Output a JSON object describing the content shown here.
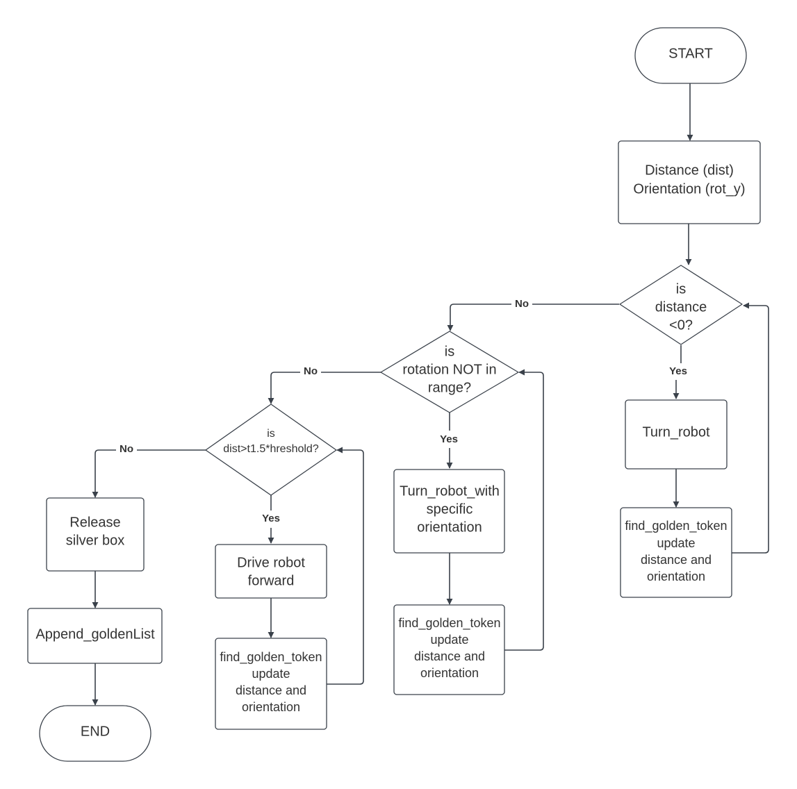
{
  "colors": {
    "line": "#3a414a",
    "text": "#333333",
    "background": "#ffffff"
  },
  "nodes": {
    "start": "START",
    "inputs": [
      "Distance (dist)",
      "Orientation (rot_y)"
    ],
    "decision_distance": [
      "is",
      "distance",
      "<0?"
    ],
    "turn_robot": "Turn_robot",
    "find_token_1": [
      "find_golden_token",
      "update",
      "distance and",
      "orientation"
    ],
    "decision_rotation": [
      "is",
      "rotation NOT in",
      "range?"
    ],
    "turn_robot_orientation": [
      "Turn_robot_with",
      "specific",
      "orientation"
    ],
    "find_token_2": [
      "find_golden_token",
      "update",
      "distance and",
      "orientation"
    ],
    "decision_threshold": [
      "is",
      "dist>t1.5*hreshold?"
    ],
    "drive_forward": [
      "Drive robot",
      "forward"
    ],
    "find_token_3": [
      "find_golden_token",
      "update",
      "distance and",
      "orientation"
    ],
    "release_box": [
      "Release",
      "silver box"
    ],
    "append_list": "Append_goldenList",
    "end": "END"
  },
  "edge_labels": {
    "yes": "Yes",
    "no": "No"
  }
}
